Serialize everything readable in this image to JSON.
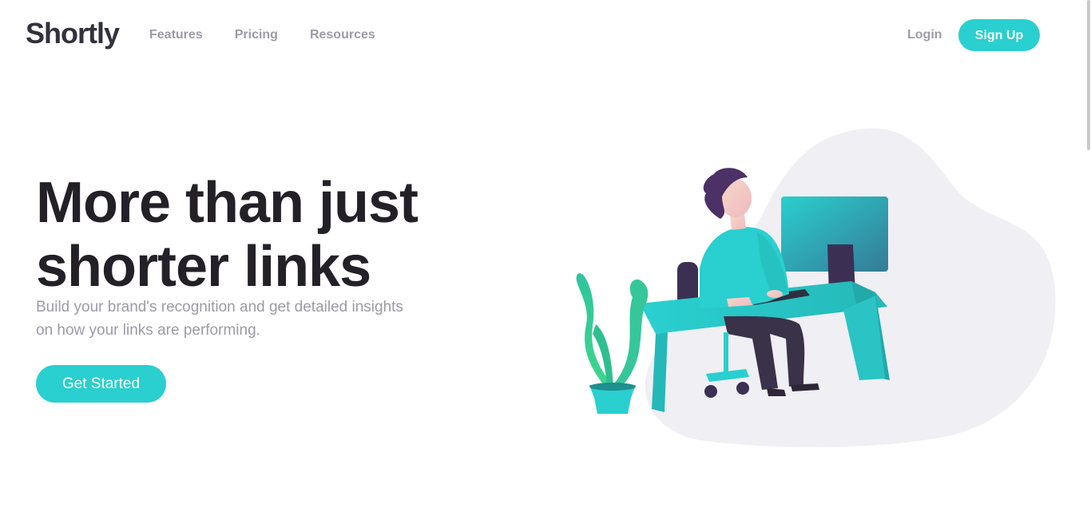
{
  "header": {
    "logo": "Shortly",
    "nav": [
      "Features",
      "Pricing",
      "Resources"
    ],
    "login_label": "Login",
    "signup_label": "Sign Up"
  },
  "hero": {
    "title_line1": "More than just",
    "title_line2": "shorter links",
    "subtitle": "Build your brand's recognition and get detailed insights on how your links are performing.",
    "cta_label": "Get Started"
  },
  "colors": {
    "accent": "#2acfcf",
    "dark": "#232127",
    "gray": "#9e9aa7",
    "blob": "#efeff4"
  },
  "illustration": {
    "icon": "person-working-at-desk-illustration"
  }
}
